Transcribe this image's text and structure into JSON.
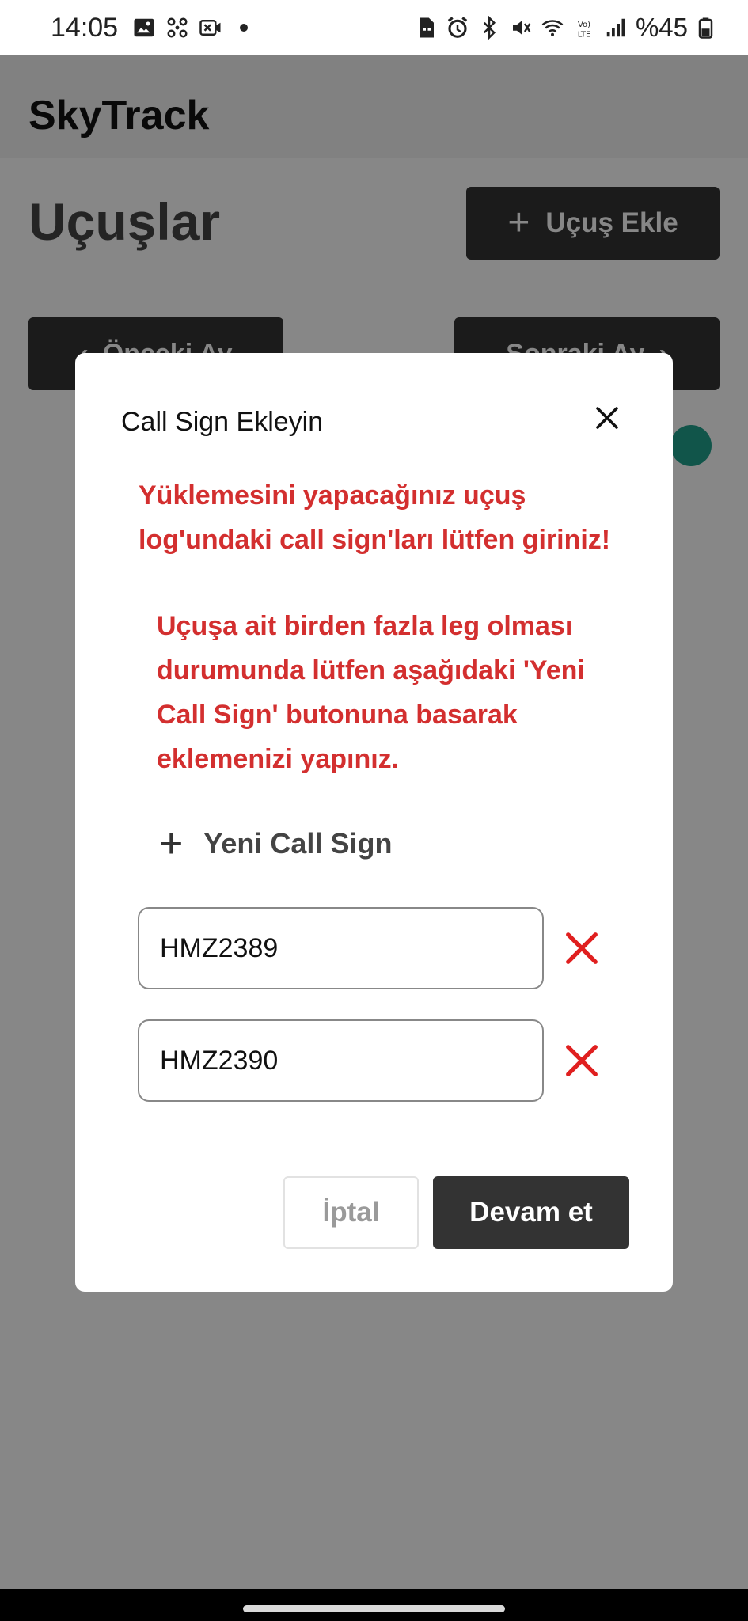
{
  "status_bar": {
    "time": "14:05",
    "battery_text": "%45",
    "left_icons": [
      "image-icon",
      "fan-icon",
      "video-icon",
      "dot-icon"
    ],
    "right_icons": [
      "sim-icon",
      "alarm-icon",
      "bluetooth-icon",
      "mute-icon",
      "wifi-icon",
      "volte-icon",
      "signal-icon",
      "battery-icon"
    ]
  },
  "app": {
    "title": "SkyTrack",
    "page_title": "Uçuşlar",
    "add_flight_label": "Uçuş Ekle",
    "prev_label": "Önceki Ay",
    "next_label": "Sonraki Ay"
  },
  "modal": {
    "title": "Call Sign Ekleyin",
    "message_1": "Yüklemesini yapacağınız uçuş log'undaki call sign'ları lütfen giriniz!",
    "message_2": "Uçuşa ait birden fazla leg olması durumunda lütfen aşağıdaki 'Yeni Call Sign' butonuna basarak eklemenizi yapınız.",
    "new_call_sign_label": "Yeni Call Sign",
    "call_signs": [
      {
        "value": "HMZ2389"
      },
      {
        "value": "HMZ2390"
      }
    ],
    "cancel_label": "İptal",
    "continue_label": "Devam et"
  },
  "colors": {
    "accent_dark": "#333333",
    "error_red": "#d32f2f",
    "delete_red": "#e01f1f",
    "fab_teal": "#21a08c"
  }
}
